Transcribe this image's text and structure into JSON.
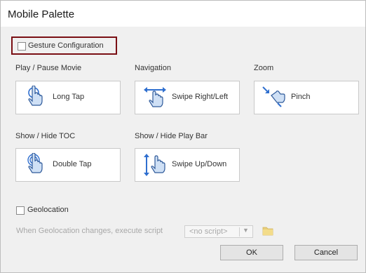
{
  "window": {
    "title": "Mobile Palette"
  },
  "gesture_config": {
    "label": "Gesture Configuration",
    "checked": false
  },
  "sections": {
    "play_pause": {
      "label": "Play / Pause Movie",
      "tile": "Long Tap",
      "icon": "hand-tap-icon"
    },
    "navigation": {
      "label": "Navigation",
      "tile": "Swipe Right/Left",
      "icon": "hand-swipe-horizontal-icon"
    },
    "zoom": {
      "label": "Zoom",
      "tile": "Pinch",
      "icon": "hand-pinch-icon"
    },
    "toc": {
      "label": "Show / Hide TOC",
      "tile": "Double Tap",
      "icon": "hand-double-tap-icon"
    },
    "playbar": {
      "label": "Show / Hide Play Bar",
      "tile": "Swipe Up/Down",
      "icon": "hand-swipe-vertical-icon"
    }
  },
  "geolocation": {
    "label": "Geolocation",
    "checked": false,
    "exec_label": "When Geolocation changes, execute script",
    "script_value": "<no script>",
    "folder_icon": "folder-icon"
  },
  "buttons": {
    "ok": "OK",
    "cancel": "Cancel"
  },
  "colors": {
    "highlight_border": "#7a0f14",
    "accent_blue": "#2f6fcf",
    "hand_fill": "#cfe0f5",
    "hand_stroke": "#2f5a9a"
  }
}
